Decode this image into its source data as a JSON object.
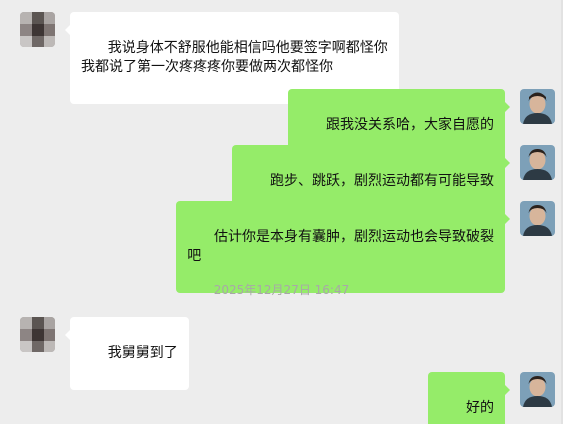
{
  "messages": [
    {
      "side": "left",
      "text": "我说身体不舒服他能相信吗他要签字啊都怪你\n我都说了第一次疼疼疼你要做两次都怪你"
    },
    {
      "side": "right",
      "text": "跟我没关系哈，大家自愿的"
    },
    {
      "side": "right",
      "text": "跑步、跳跃，剧烈运动都有可能导致"
    },
    {
      "side": "right",
      "text": "估计你是本身有囊肿，剧烈运动也会导致破裂\n吧"
    },
    {
      "side": "left",
      "text": "我舅舅到了"
    },
    {
      "side": "right",
      "text": "好的"
    }
  ],
  "timestamp": "2025年12月27日 16:47",
  "colors": {
    "background": "#ededed",
    "self_bubble": "#95ec69",
    "other_bubble": "#ffffff",
    "timestamp_text": "#a8a8a8"
  }
}
